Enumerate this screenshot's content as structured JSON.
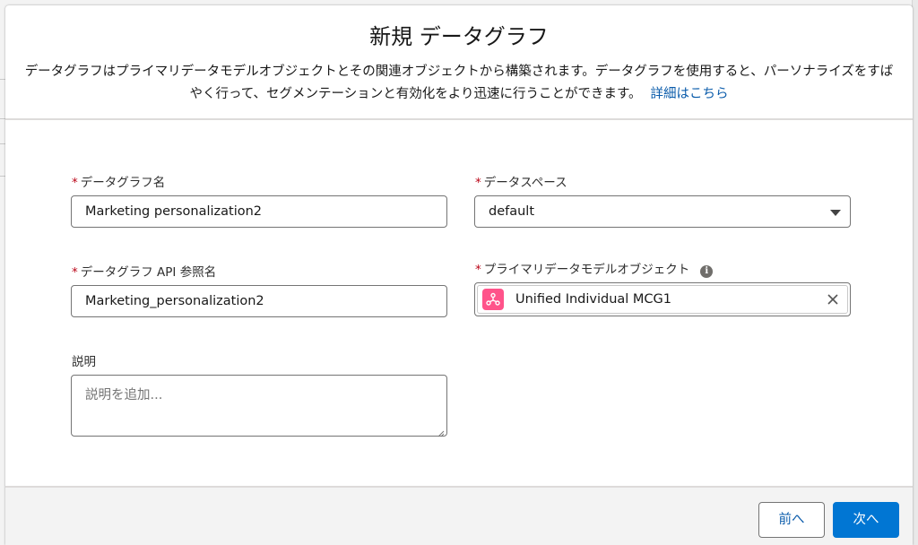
{
  "modal": {
    "title": "新規 データグラフ",
    "description": "データグラフはプライマリデータモデルオブジェクトとその関連オブジェクトから構築されます。データグラフを使用すると、パーソナライズをすばやく行って、セグメンテーションと有効化をより迅速に行うことができます。",
    "learn_more": "詳細はこちら"
  },
  "form": {
    "required_marker": "*",
    "graph_name": {
      "label": "データグラフ名",
      "value": "Marketing personalization2"
    },
    "data_space": {
      "label": "データスペース",
      "value": "default"
    },
    "api_name": {
      "label": "データグラフ API 参照名",
      "value": "Marketing_personalization2"
    },
    "primary_object": {
      "label": "プライマリデータモデルオブジェクト",
      "value": "Unified Individual MCG1",
      "info_icon": "info-icon"
    },
    "description": {
      "label": "説明",
      "placeholder": "説明を追加..."
    }
  },
  "footer": {
    "prev_label": "前へ",
    "next_label": "次へ"
  },
  "colors": {
    "brand_button": "#0176d3",
    "link": "#0b5cab",
    "required": "#ba0517",
    "object_icon": "#ff538a"
  }
}
